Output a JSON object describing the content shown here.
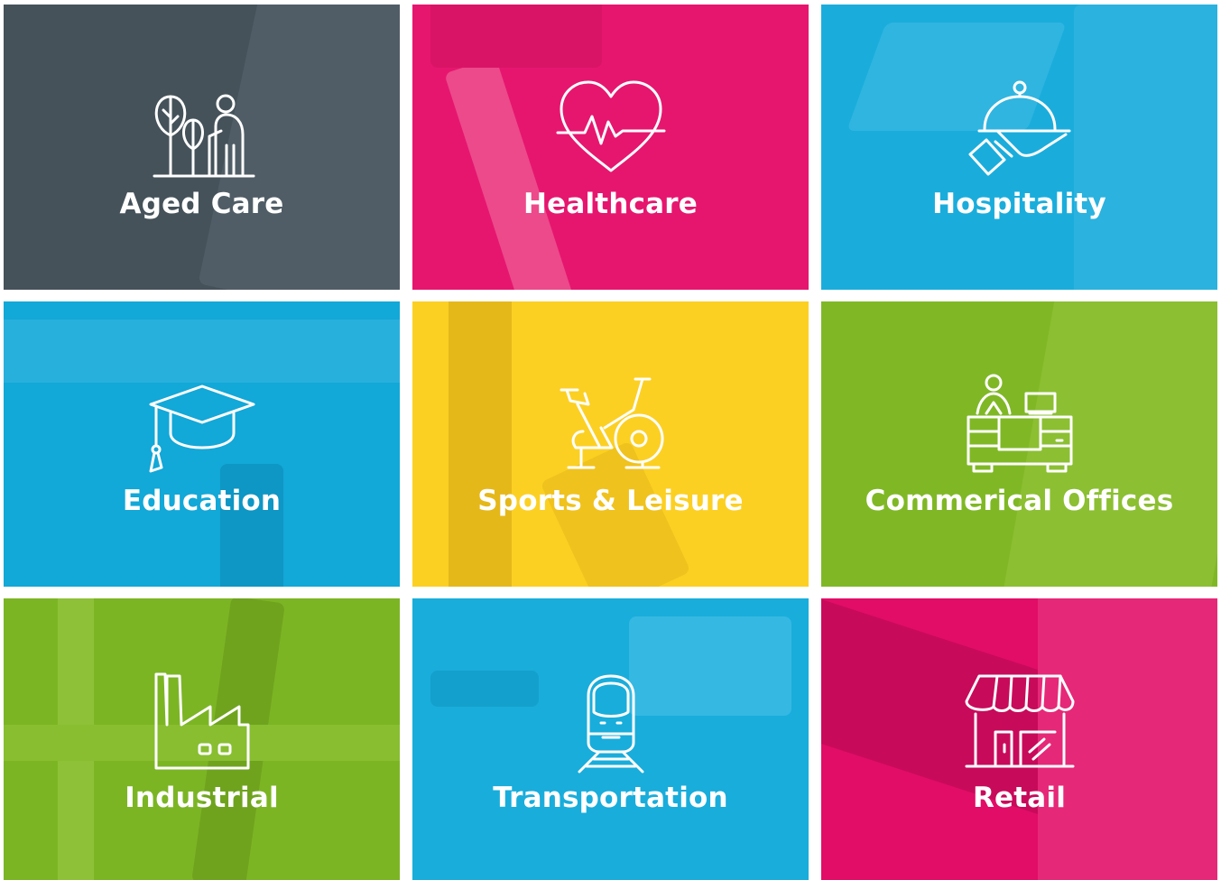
{
  "tiles": [
    {
      "label": "Aged Care",
      "icon": "aged-care-icon",
      "color": "#45525a"
    },
    {
      "label": "Healthcare",
      "icon": "heart-pulse-icon",
      "color": "#e6166f"
    },
    {
      "label": "Hospitality",
      "icon": "cloche-icon",
      "color": "#1aaddc"
    },
    {
      "label": "Education",
      "icon": "graduation-cap-icon",
      "color": "#12a8d8"
    },
    {
      "label": "Sports & Leisure",
      "icon": "exercise-bike-icon",
      "color": "#fcd023"
    },
    {
      "label": "Commerical Offices",
      "icon": "office-desk-icon",
      "color": "#80b825"
    },
    {
      "label": "Industrial",
      "icon": "factory-icon",
      "color": "#7cb524"
    },
    {
      "label": "Transportation",
      "icon": "train-icon",
      "color": "#19addb"
    },
    {
      "label": "Retail",
      "icon": "storefront-icon",
      "color": "#e10d67"
    }
  ]
}
